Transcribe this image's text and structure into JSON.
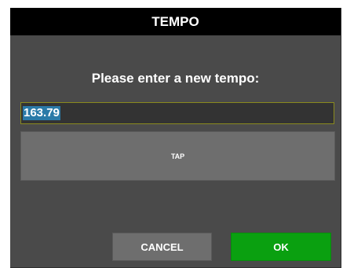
{
  "dialog": {
    "title": "TEMPO",
    "prompt": "Please enter a new tempo:",
    "input": {
      "value": "163.79"
    },
    "tap_label": "TAP",
    "cancel_label": "CANCEL",
    "ok_label": "OK"
  },
  "colors": {
    "titlebar": "#000000",
    "dialog_bg": "#4a4a4a",
    "input_bg": "#333333",
    "input_border": "#8a8a1e",
    "selection": "#2a7aa8",
    "tap_bg": "#6e6e6e",
    "cancel_bg": "#6e6e6e",
    "ok_bg": "#0aa010"
  }
}
